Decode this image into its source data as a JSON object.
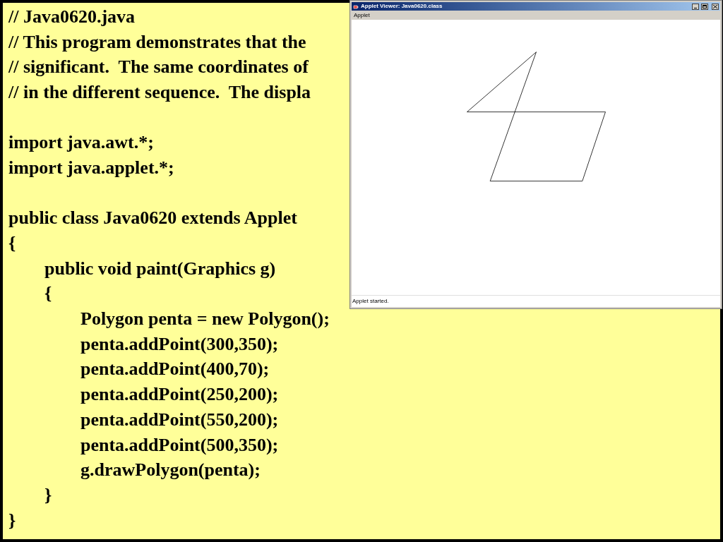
{
  "code": [
    {
      "kind": "line",
      "text": "// Java0620.java"
    },
    {
      "kind": "line",
      "text": "// This program demonstrates that the"
    },
    {
      "kind": "line",
      "text": "// significant.  The same coordinates of"
    },
    {
      "kind": "line",
      "text": "// in the different sequence.  The displa"
    },
    {
      "kind": "blank"
    },
    {
      "kind": "line",
      "text": "import java.awt.*;"
    },
    {
      "kind": "line",
      "text": "import java.applet.*;"
    },
    {
      "kind": "blank"
    },
    {
      "kind": "line",
      "text": "public class Java0620 extends Applet"
    },
    {
      "kind": "line",
      "text": "{",
      "children": [
        {
          "kind": "line",
          "text": "public void paint(Graphics g)"
        },
        {
          "kind": "line",
          "text": "{",
          "children": [
            {
              "kind": "line",
              "text": "Polygon penta = new Polygon();"
            },
            {
              "kind": "line",
              "text": "penta.addPoint(300,350);"
            },
            {
              "kind": "line",
              "text": "penta.addPoint(400,70);"
            },
            {
              "kind": "line",
              "text": "penta.addPoint(250,200);"
            },
            {
              "kind": "line",
              "text": "penta.addPoint(550,200);"
            },
            {
              "kind": "line",
              "text": "penta.addPoint(500,350);"
            },
            {
              "kind": "line",
              "text": "g.drawPolygon(penta);"
            }
          ]
        },
        {
          "kind": "line",
          "text": "}"
        }
      ]
    },
    {
      "kind": "line",
      "text": "}"
    }
  ],
  "applet_window": {
    "title": "Applet Viewer: Java0620.class",
    "menu": [
      "Applet"
    ],
    "status": "Applet started."
  }
}
